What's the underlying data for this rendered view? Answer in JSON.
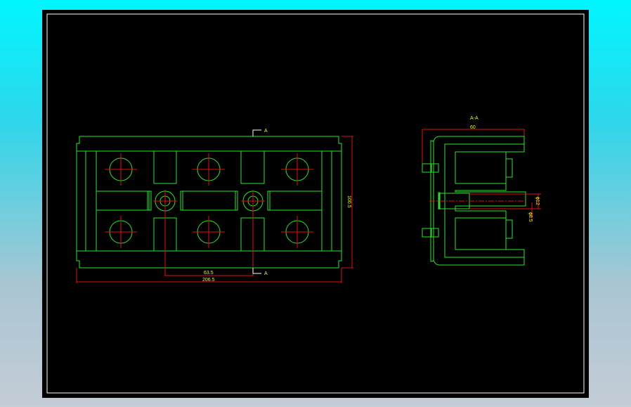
{
  "front_view": {
    "section_marker_top": "A",
    "section_marker_bottom": "A",
    "dim_center_spacing": "63.5",
    "dim_overall_width": "206.5",
    "dim_overall_height": "100.5"
  },
  "section_view": {
    "title": "A-A",
    "dim_depth": "60",
    "dim_bore_dia": "ϕ12",
    "dim_shaft_dia": "ϕ8.5"
  },
  "colors": {
    "outline": "#27e627",
    "dimension": "#e01010",
    "text": "#f0f020",
    "hatch": "#f0f020"
  }
}
